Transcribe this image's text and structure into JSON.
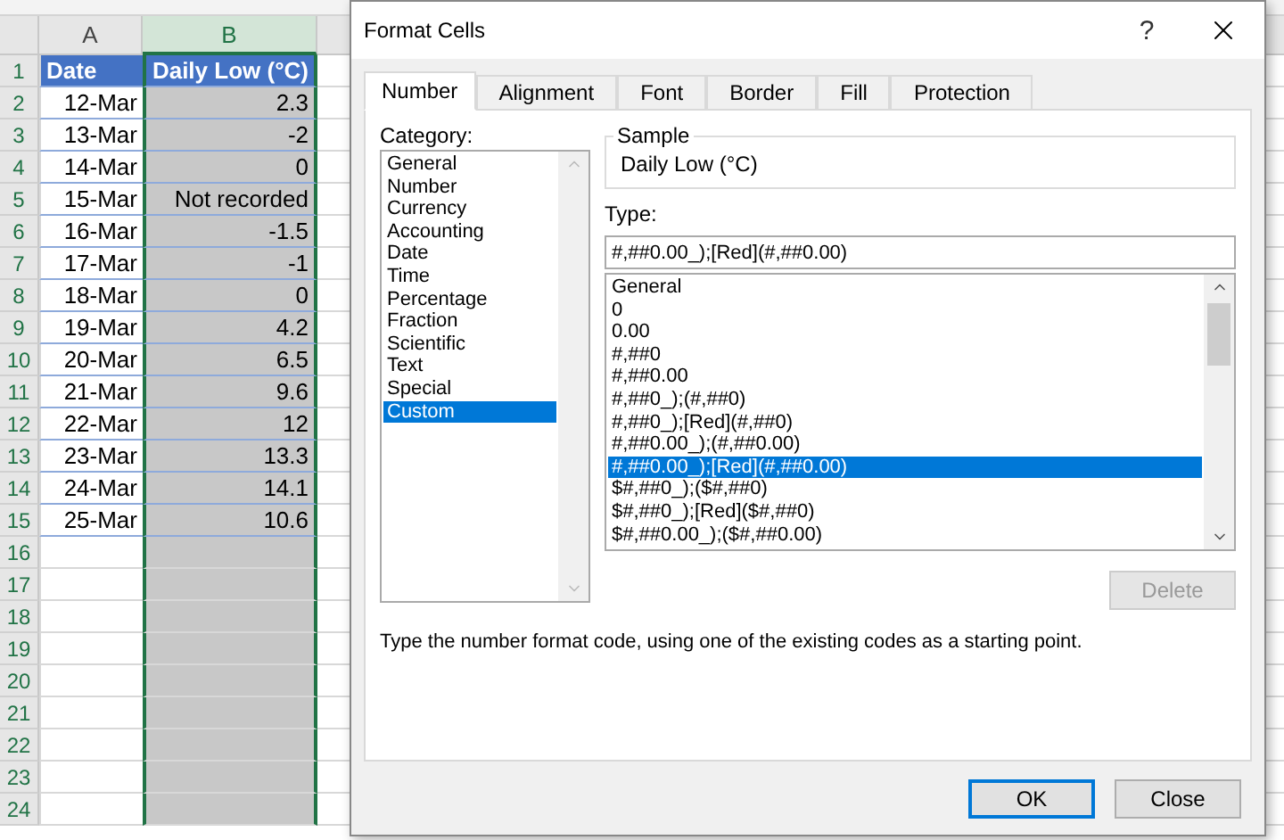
{
  "sheet": {
    "columns": [
      {
        "label": "A",
        "selected": false
      },
      {
        "label": "B",
        "selected": true
      }
    ],
    "rows": [
      {
        "number": "1",
        "kind": "header",
        "cells": [
          "Date",
          "Daily Low (°C)"
        ]
      },
      {
        "number": "2",
        "kind": "data",
        "cells": [
          "12-Mar",
          "2.3"
        ]
      },
      {
        "number": "3",
        "kind": "data",
        "cells": [
          "13-Mar",
          "-2"
        ]
      },
      {
        "number": "4",
        "kind": "data",
        "cells": [
          "14-Mar",
          "0"
        ]
      },
      {
        "number": "5",
        "kind": "data",
        "cells": [
          "15-Mar",
          "Not recorded"
        ]
      },
      {
        "number": "6",
        "kind": "data",
        "cells": [
          "16-Mar",
          "-1.5"
        ]
      },
      {
        "number": "7",
        "kind": "data",
        "cells": [
          "17-Mar",
          "-1"
        ]
      },
      {
        "number": "8",
        "kind": "data",
        "cells": [
          "18-Mar",
          "0"
        ]
      },
      {
        "number": "9",
        "kind": "data",
        "cells": [
          "19-Mar",
          "4.2"
        ]
      },
      {
        "number": "10",
        "kind": "data",
        "cells": [
          "20-Mar",
          "6.5"
        ]
      },
      {
        "number": "11",
        "kind": "data",
        "cells": [
          "21-Mar",
          "9.6"
        ]
      },
      {
        "number": "12",
        "kind": "data",
        "cells": [
          "22-Mar",
          "12"
        ]
      },
      {
        "number": "13",
        "kind": "data",
        "cells": [
          "23-Mar",
          "13.3"
        ]
      },
      {
        "number": "14",
        "kind": "data",
        "cells": [
          "24-Mar",
          "14.1"
        ]
      },
      {
        "number": "15",
        "kind": "data",
        "cells": [
          "25-Mar",
          "10.6"
        ]
      },
      {
        "number": "16",
        "kind": "empty",
        "cells": []
      },
      {
        "number": "17",
        "kind": "empty",
        "cells": []
      },
      {
        "number": "18",
        "kind": "empty",
        "cells": []
      },
      {
        "number": "19",
        "kind": "empty",
        "cells": []
      },
      {
        "number": "20",
        "kind": "empty",
        "cells": []
      },
      {
        "number": "21",
        "kind": "empty",
        "cells": []
      },
      {
        "number": "22",
        "kind": "empty",
        "cells": []
      },
      {
        "number": "23",
        "kind": "empty",
        "cells": []
      },
      {
        "number": "24",
        "kind": "empty",
        "cells": []
      }
    ]
  },
  "dialog": {
    "title": "Format Cells",
    "help": "?",
    "tabs": [
      {
        "label": "Number",
        "selected": true
      },
      {
        "label": "Alignment",
        "selected": false
      },
      {
        "label": "Font",
        "selected": false
      },
      {
        "label": "Border",
        "selected": false
      },
      {
        "label": "Fill",
        "selected": false
      },
      {
        "label": "Protection",
        "selected": false
      }
    ],
    "category_label": "Category:",
    "categories": [
      {
        "label": "General",
        "selected": false
      },
      {
        "label": "Number",
        "selected": false
      },
      {
        "label": "Currency",
        "selected": false
      },
      {
        "label": "Accounting",
        "selected": false
      },
      {
        "label": "Date",
        "selected": false
      },
      {
        "label": "Time",
        "selected": false
      },
      {
        "label": "Percentage",
        "selected": false
      },
      {
        "label": "Fraction",
        "selected": false
      },
      {
        "label": "Scientific",
        "selected": false
      },
      {
        "label": "Text",
        "selected": false
      },
      {
        "label": "Special",
        "selected": false
      },
      {
        "label": "Custom",
        "selected": true
      }
    ],
    "sample_label": "Sample",
    "sample_value": "Daily Low (°C)",
    "type_label": "Type:",
    "type_value": "#,##0.00_);[Red](#,##0.00)",
    "formats": [
      {
        "label": "General",
        "selected": false
      },
      {
        "label": "0",
        "selected": false
      },
      {
        "label": "0.00",
        "selected": false
      },
      {
        "label": "#,##0",
        "selected": false
      },
      {
        "label": "#,##0.00",
        "selected": false
      },
      {
        "label": "#,##0_);(#,##0)",
        "selected": false
      },
      {
        "label": "#,##0_);[Red](#,##0)",
        "selected": false
      },
      {
        "label": "#,##0.00_);(#,##0.00)",
        "selected": false
      },
      {
        "label": "#,##0.00_);[Red](#,##0.00)",
        "selected": true
      },
      {
        "label": "$#,##0_);($#,##0)",
        "selected": false
      },
      {
        "label": "$#,##0_);[Red]($#,##0)",
        "selected": false
      },
      {
        "label": "$#,##0.00_);($#,##0.00)",
        "selected": false
      }
    ],
    "delete": {
      "label": "Delete",
      "disabled": true
    },
    "description": "Type the number format code, using one of the existing codes as a starting point.",
    "buttons": [
      {
        "label": "OK",
        "default": true
      },
      {
        "label": "Close",
        "default": false
      }
    ]
  }
}
